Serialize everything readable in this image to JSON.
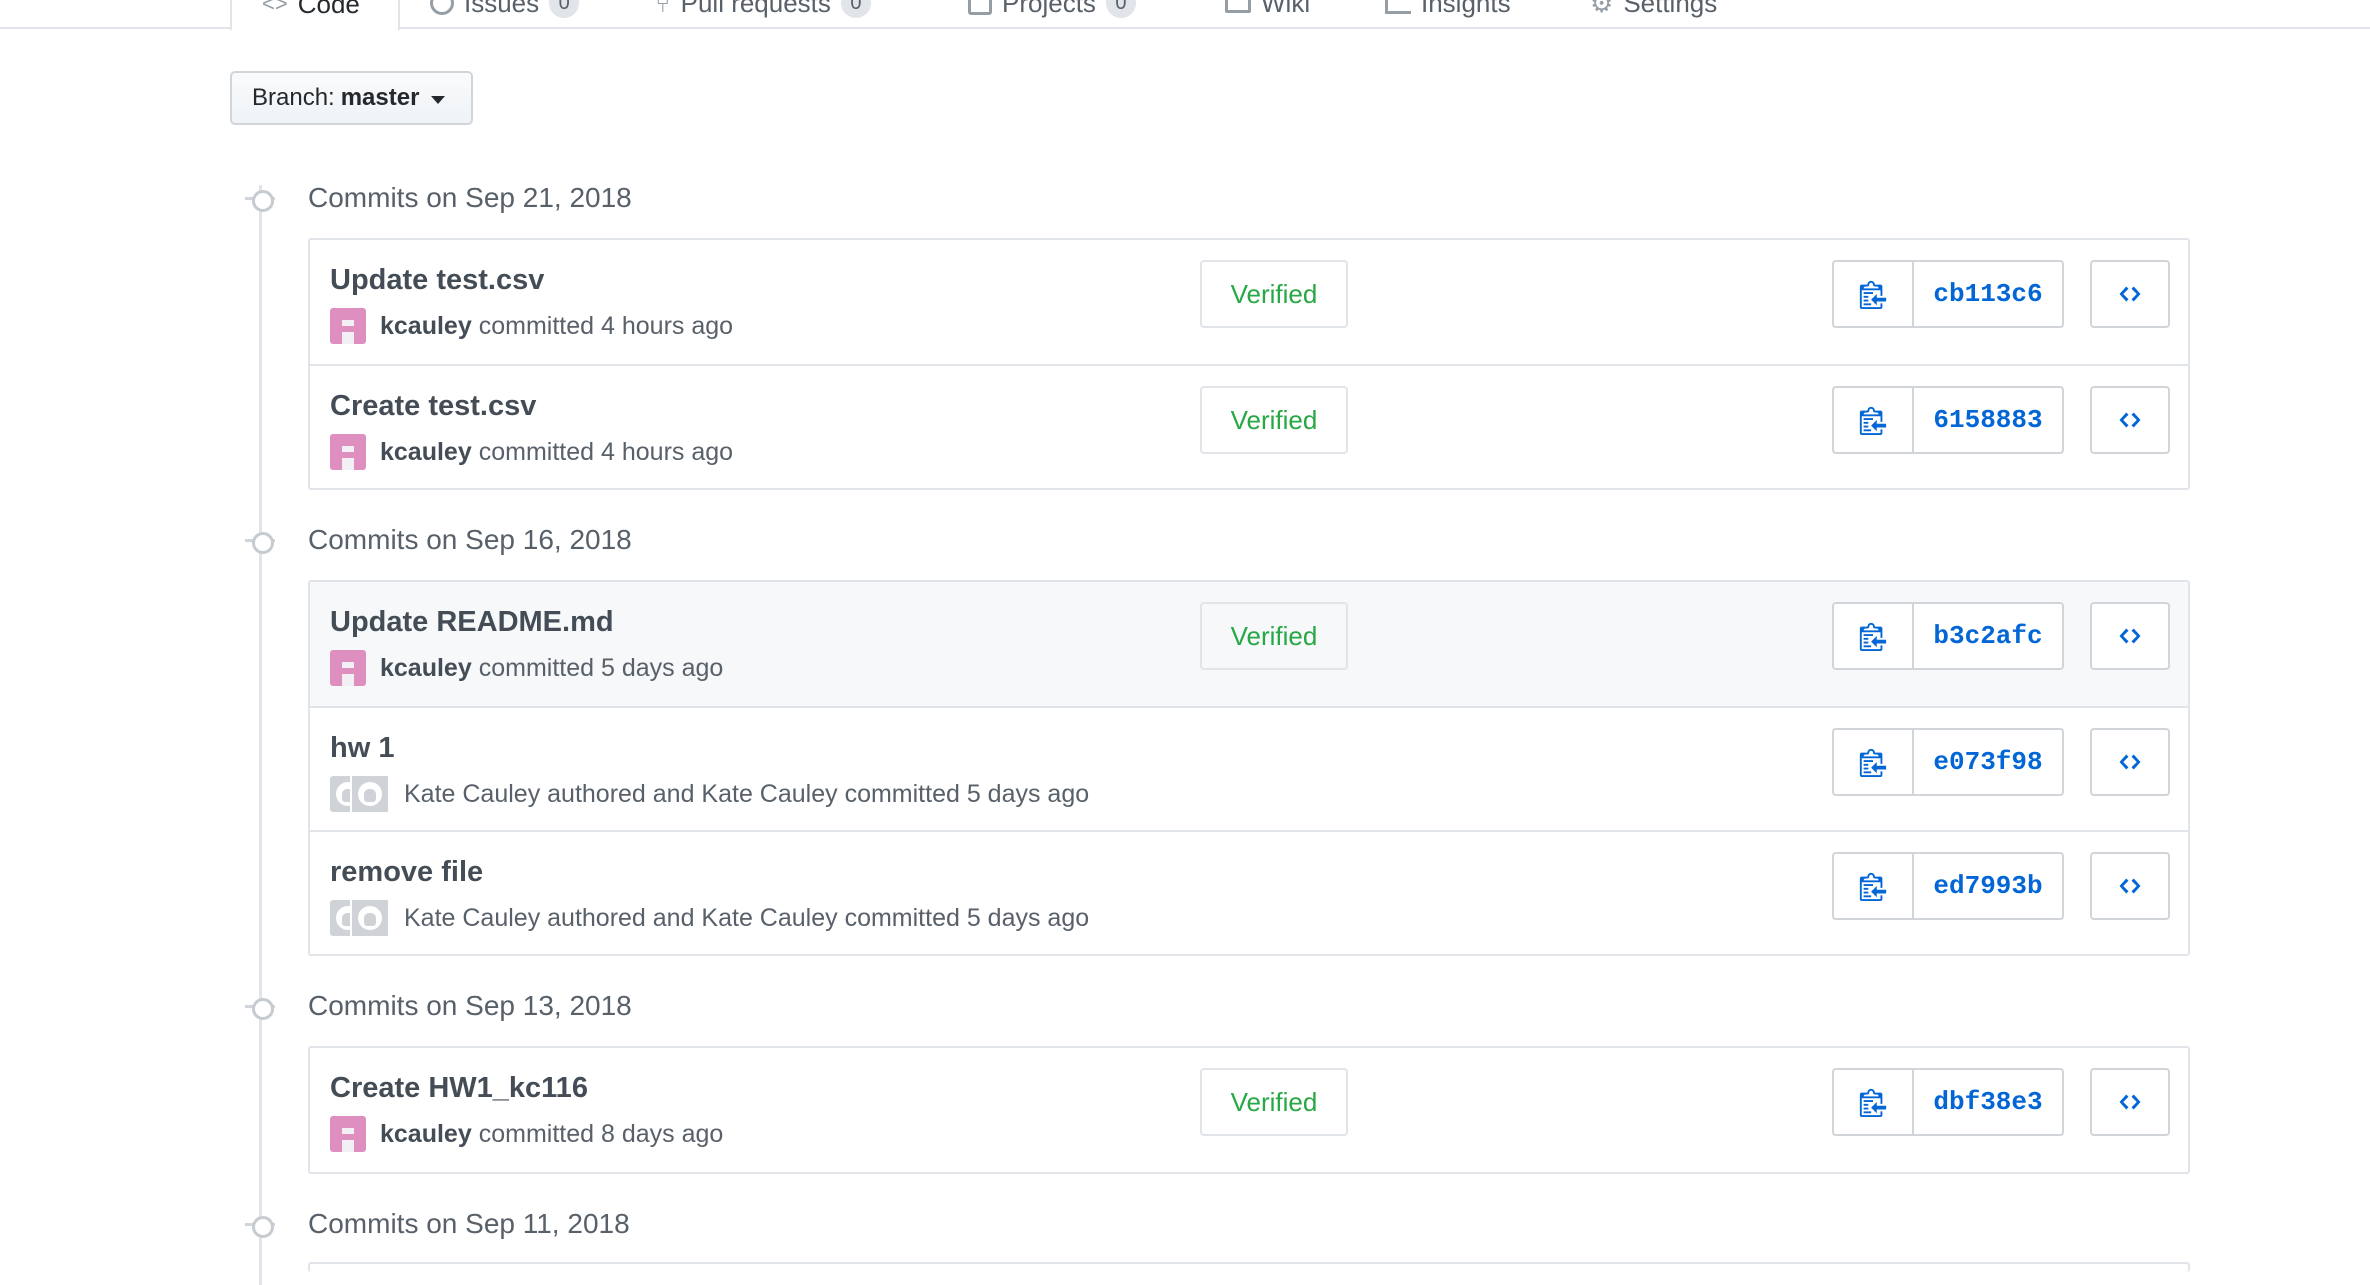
{
  "nav": {
    "tabs": [
      {
        "label": "Code",
        "selected": true
      },
      {
        "label": "Issues",
        "count": "0"
      },
      {
        "label": "Pull requests",
        "count": "0"
      },
      {
        "label": "Projects",
        "count": "0"
      },
      {
        "label": "Wiki"
      },
      {
        "label": "Insights"
      },
      {
        "label": "Settings"
      }
    ]
  },
  "branch": {
    "prefix": "Branch:",
    "name": "master"
  },
  "groups": [
    {
      "title": "Commits on Sep 21, 2018",
      "commits": [
        {
          "title": "Update test.csv",
          "author": "kcauley",
          "action": "committed 4 hours ago",
          "verified": "Verified",
          "sha": "cb113c6"
        },
        {
          "title": "Create test.csv",
          "author": "kcauley",
          "action": "committed 4 hours ago",
          "verified": "Verified",
          "sha": "6158883"
        }
      ]
    },
    {
      "title": "Commits on Sep 16, 2018",
      "commits": [
        {
          "title": "Update README.md",
          "author": "kcauley",
          "action": "committed 5 days ago",
          "verified": "Verified",
          "sha": "b3c2afc"
        },
        {
          "title": "hw 1",
          "meta": "Kate Cauley authored and Kate Cauley committed 5 days ago",
          "sha": "e073f98"
        },
        {
          "title": "remove file",
          "meta": "Kate Cauley authored and Kate Cauley committed 5 days ago",
          "sha": "ed7993b"
        }
      ]
    },
    {
      "title": "Commits on Sep 13, 2018",
      "commits": [
        {
          "title": "Create HW1_kc116",
          "author": "kcauley",
          "action": "committed 8 days ago",
          "verified": "Verified",
          "sha": "dbf38e3"
        }
      ]
    },
    {
      "title": "Commits on Sep 11, 2018",
      "commits": []
    }
  ],
  "colors": {
    "accent": "#0366d6",
    "verified": "#28a745",
    "identicon": "#de8fc0"
  },
  "icons": {
    "copy": "clippy-icon",
    "browse": "code-icon",
    "branch_caret": "caret-down-icon"
  }
}
